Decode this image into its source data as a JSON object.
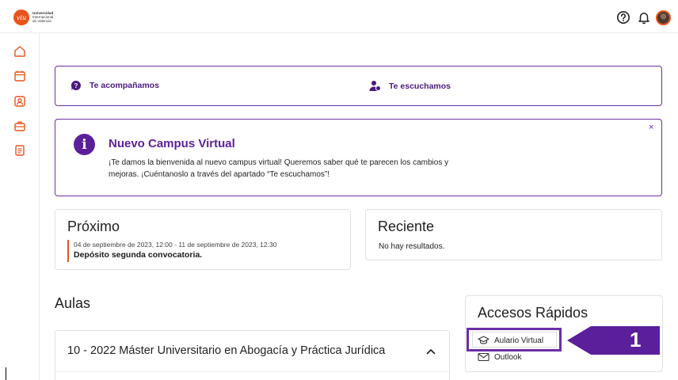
{
  "header": {
    "logo_mark": "viu",
    "logo_line1": "Universidad",
    "logo_line2": "Internacional",
    "logo_line3": "de Valencia",
    "icons": [
      "help-icon",
      "bell-icon",
      "avatar"
    ]
  },
  "sidebar": {
    "items": [
      "home-icon",
      "calendar-icon",
      "profile-icon",
      "briefcase-icon",
      "document-icon"
    ]
  },
  "support": {
    "left_label": "Te acompañamos",
    "right_label": "Te escuchamos"
  },
  "notice": {
    "title": "Nuevo Campus Virtual",
    "body": "¡Te damos la bienvenida al nuevo campus virtual! Queremos saber qué te parecen los cambios y mejoras. ¡Cuéntanoslo a través del apartado “Te escuchamos”!",
    "close": "×"
  },
  "proximo": {
    "title": "Próximo",
    "event_date": "04 de septiembre de 2023, 12:00 - 11 de septiembre de 2023, 12:30",
    "event_name": "Depósito segunda convocatoria."
  },
  "reciente": {
    "title": "Reciente",
    "empty": "No hay resultados."
  },
  "aulas": {
    "title": "Aulas",
    "course": "10 - 2022 Máster Universitario en Abogacía y Práctica Jurídica"
  },
  "accesos": {
    "title": "Accesos Rápidos",
    "links": [
      {
        "label": "Aulario Virtual",
        "icon": "graduation-cap-icon"
      },
      {
        "label": "Outlook",
        "icon": "mail-icon"
      }
    ]
  },
  "annotation": {
    "number": "1",
    "color": "#5b1f9b"
  },
  "colors": {
    "accent": "#6b2fa6",
    "brand": "#e8541c"
  }
}
